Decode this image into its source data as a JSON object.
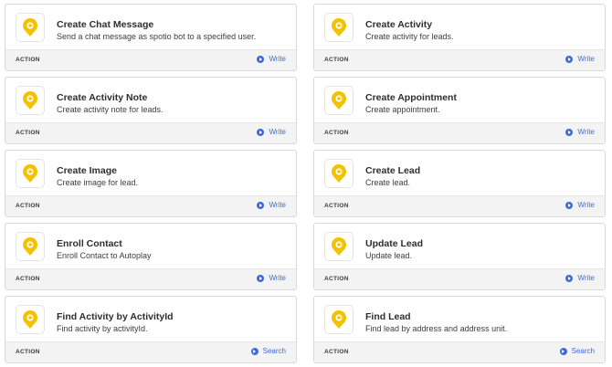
{
  "cards": [
    {
      "title": "Create Chat Message",
      "description": "Send a chat message as spotio bot to a specified user.",
      "type": "ACTION",
      "action": "Write"
    },
    {
      "title": "Create Activity",
      "description": "Create activity for leads.",
      "type": "ACTION",
      "action": "Write"
    },
    {
      "title": "Create Activity Note",
      "description": "Create activity note for leads.",
      "type": "ACTION",
      "action": "Write"
    },
    {
      "title": "Create Appointment",
      "description": "Create appointment.",
      "type": "ACTION",
      "action": "Write"
    },
    {
      "title": "Create Image",
      "description": "Create image for lead.",
      "type": "ACTION",
      "action": "Write"
    },
    {
      "title": "Create Lead",
      "description": "Create lead.",
      "type": "ACTION",
      "action": "Write"
    },
    {
      "title": "Enroll Contact",
      "description": "Enroll Contact to Autoplay",
      "type": "ACTION",
      "action": "Write"
    },
    {
      "title": "Update Lead",
      "description": "Update lead.",
      "type": "ACTION",
      "action": "Write"
    },
    {
      "title": "Find Activity by ActivityId",
      "description": "Find activity by activityId.",
      "type": "ACTION",
      "action": "Search"
    },
    {
      "title": "Find Lead",
      "description": "Find lead by address and address unit.",
      "type": "ACTION",
      "action": "Search"
    }
  ],
  "icons": {
    "app_logo": "spotio-pin-icon",
    "link": "arrow-circle-icon"
  },
  "colors": {
    "brand_yellow": "#f2c200",
    "link_blue": "#3d6bd6",
    "footer_bg": "#f3f3f3"
  }
}
